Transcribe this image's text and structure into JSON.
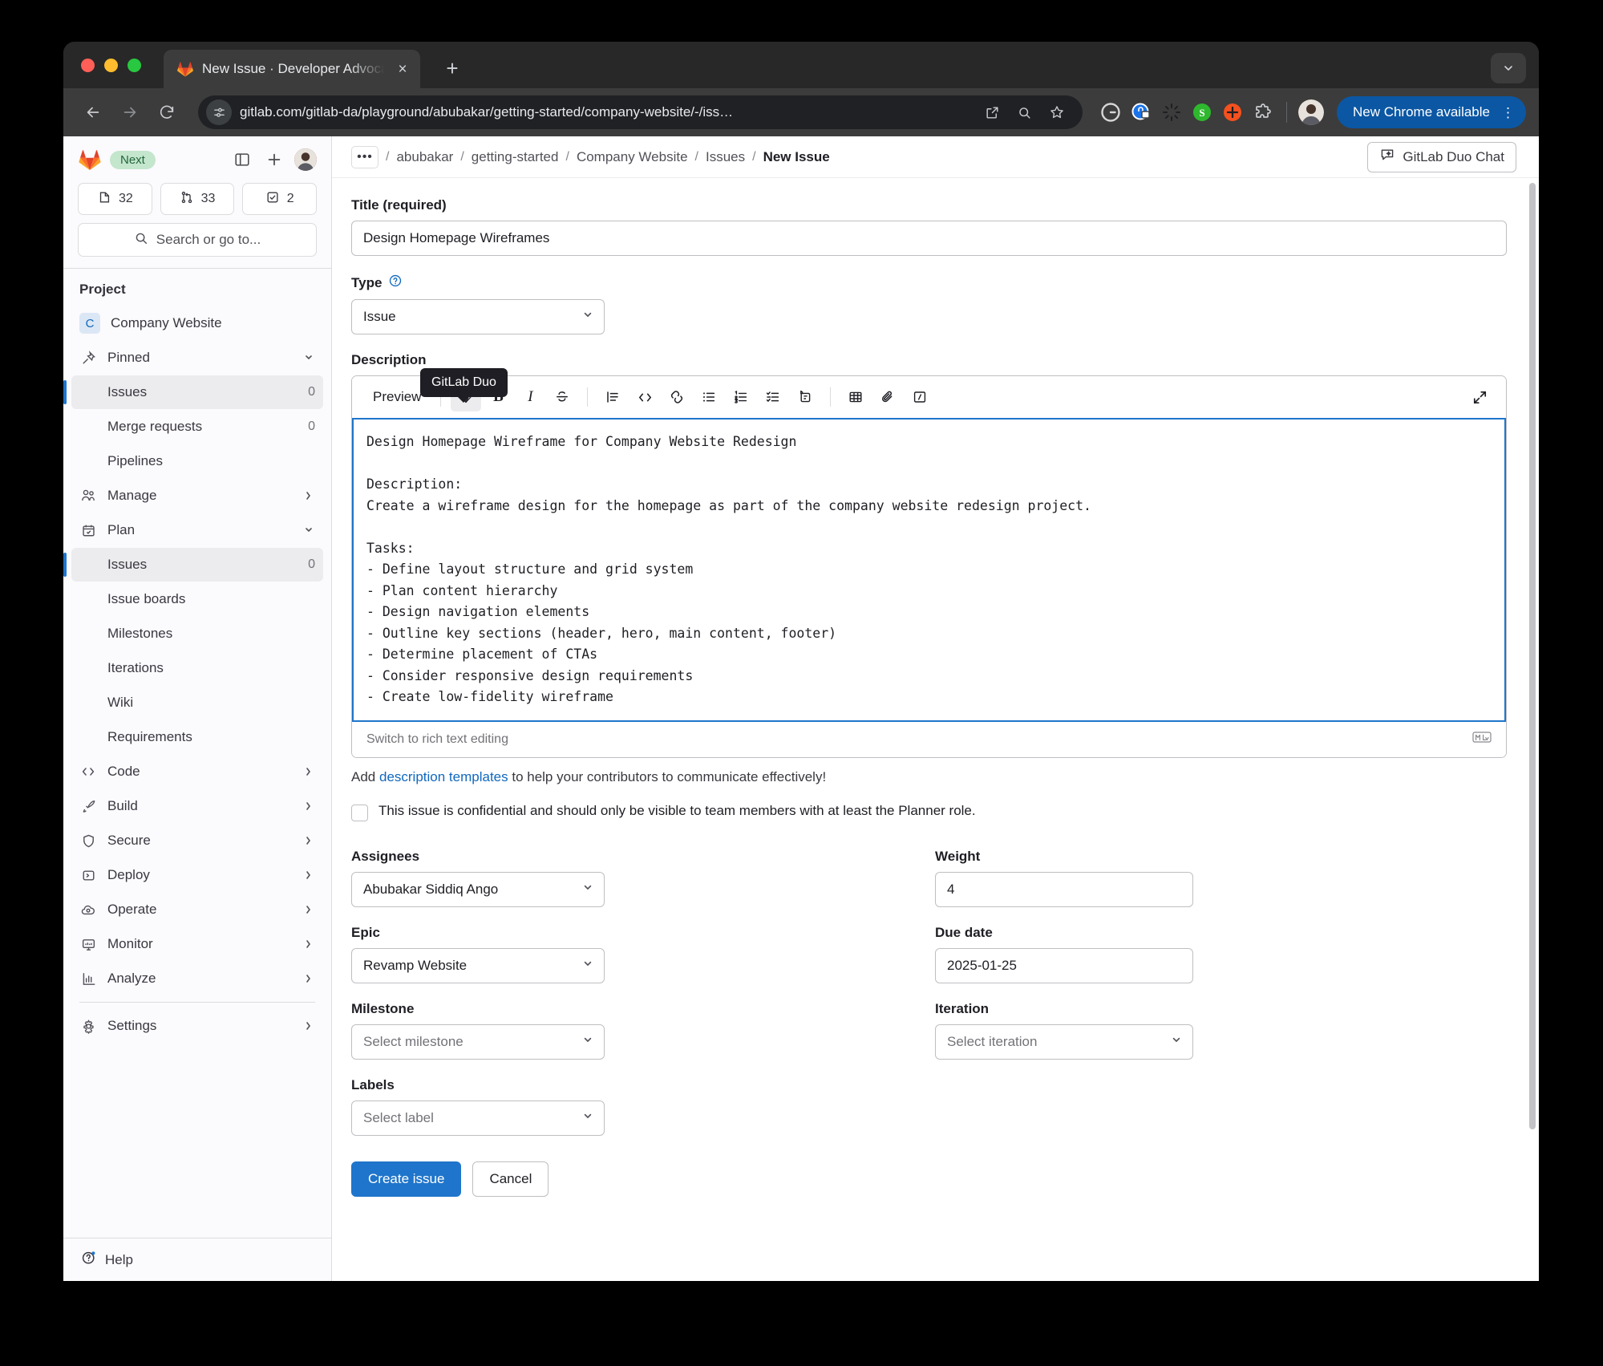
{
  "browser": {
    "tab": {
      "title": "New Issue · Developer Advoca",
      "close_label": "×",
      "favicon": "gitlab-fox-icon"
    },
    "newtab_label": "+",
    "url": "gitlab.com/gitlab-da/playground/abubakar/getting-started/company-website/-/iss…",
    "update_button": "New Chrome available",
    "kebab_label": "⋮"
  },
  "sidebar": {
    "brand_badge": "Next",
    "counts": [
      {
        "name": "issues",
        "icon": "issue-icon",
        "value": "32"
      },
      {
        "name": "merge-requests",
        "icon": "merge-request-icon",
        "value": "33"
      },
      {
        "name": "todos",
        "icon": "todo-check-icon",
        "value": "2"
      }
    ],
    "search_placeholder": "Search or go to...",
    "section_label": "Project",
    "project": {
      "initial": "C",
      "name": "Company Website"
    },
    "pinned_label": "Pinned",
    "pinned_items": [
      {
        "label": "Issues",
        "count": "0",
        "active": true
      },
      {
        "label": "Merge requests",
        "count": "0",
        "active": false
      },
      {
        "label": "Pipelines",
        "count": "",
        "active": false
      }
    ],
    "groups": [
      {
        "label": "Manage",
        "icon": "users-icon"
      },
      {
        "label": "Plan",
        "icon": "calendar-icon"
      }
    ],
    "plan_items": [
      {
        "label": "Issues",
        "count": "0",
        "active": true
      },
      {
        "label": "Issue boards",
        "count": "",
        "active": false
      },
      {
        "label": "Milestones",
        "count": "",
        "active": false
      },
      {
        "label": "Iterations",
        "count": "",
        "active": false
      },
      {
        "label": "Wiki",
        "count": "",
        "active": false
      },
      {
        "label": "Requirements",
        "count": "",
        "active": false
      }
    ],
    "groups2": [
      {
        "label": "Code",
        "icon": "code-icon"
      },
      {
        "label": "Build",
        "icon": "rocket-icon"
      },
      {
        "label": "Secure",
        "icon": "shield-icon"
      },
      {
        "label": "Deploy",
        "icon": "deploy-icon"
      },
      {
        "label": "Operate",
        "icon": "cloud-gear-icon"
      },
      {
        "label": "Monitor",
        "icon": "monitor-icon"
      },
      {
        "label": "Analyze",
        "icon": "chart-icon"
      }
    ],
    "settings": {
      "label": "Settings",
      "icon": "gear-icon"
    },
    "help": {
      "label": "Help",
      "icon": "question-circle-icon"
    }
  },
  "topbar": {
    "breadcrumb_more": "•••",
    "breadcrumb": [
      "abubakar",
      "getting-started",
      "Company Website",
      "Issues"
    ],
    "breadcrumb_current": "New Issue",
    "separator": "/",
    "duo_chat_button": "GitLab Duo Chat"
  },
  "form": {
    "title_label": "Title (required)",
    "title_value": "Design Homepage Wireframes",
    "type_label": "Type",
    "type_value": "Issue",
    "description_label": "Description",
    "duo_tooltip": "GitLab Duo",
    "toolbar": {
      "preview": "Preview",
      "icons": [
        "gitlab-duo-icon",
        "bold-icon",
        "italic-icon",
        "strikethrough-icon",
        "indent-icon",
        "code-icon",
        "link-icon",
        "bullet-list-icon",
        "numbered-list-icon",
        "checklist-icon",
        "quote-icon",
        "table-icon",
        "attachment-icon",
        "slash-command-icon"
      ],
      "expand": "fullscreen-icon"
    },
    "description_value": "Design Homepage Wireframe for Company Website Redesign\n\nDescription:\nCreate a wireframe design for the homepage as part of the company website redesign project.\n\nTasks:\n- Define layout structure and grid system\n- Plan content hierarchy\n- Design navigation elements\n- Outline key sections (header, hero, main content, footer)\n- Determine placement of CTAs\n- Consider responsive design requirements\n- Create low-fidelity wireframe",
    "switch_editor_label": "Switch to rich text editing",
    "markdown_badge": "markdown-icon",
    "templates_prefix": "Add ",
    "templates_link": "description templates",
    "templates_suffix": " to help your contributors to communicate effectively!",
    "confidential_label": "This issue is confidential and should only be visible to team members with at least the Planner role.",
    "assignees_label": "Assignees",
    "assignees_value": "Abubakar Siddiq Ango",
    "weight_label": "Weight",
    "weight_value": "4",
    "epic_label": "Epic",
    "epic_value": "Revamp Website",
    "due_date_label": "Due date",
    "due_date_value": "2025-01-25",
    "milestone_label": "Milestone",
    "milestone_placeholder": "Select milestone",
    "iteration_label": "Iteration",
    "iteration_placeholder": "Select iteration",
    "labels_label": "Labels",
    "labels_placeholder": "Select label",
    "create_button": "Create issue",
    "cancel_button": "Cancel"
  },
  "colors": {
    "accent": "#1f75cb",
    "link": "#1068bf",
    "gitlab_orange": "#fc6d26",
    "badge_green_bg": "#c3e6cd",
    "chrome_pill": "#0b57a4"
  }
}
